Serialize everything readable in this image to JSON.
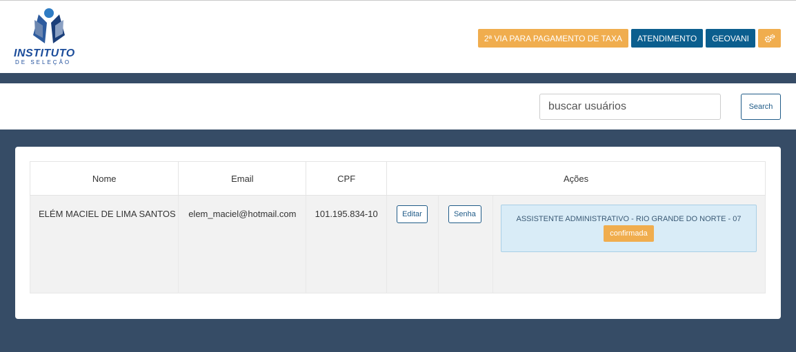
{
  "header": {
    "logo_title": "INSTITUTO",
    "logo_subtitle": "DE SELEÇÃO",
    "nav": {
      "pagamento_label": "2ª VIA PARA PAGAMENTO DE TAXA",
      "atendimento_label": "ATENDIMENTO",
      "user_label": "GEOVANI",
      "settings_icon": "gears-icon"
    },
    "colors": {
      "orange": "#f0ad4e",
      "blue": "#0b5e8e",
      "navy_bg": "#364c66"
    }
  },
  "search": {
    "placeholder": "buscar usuários",
    "value": "",
    "button_label": "Search"
  },
  "table": {
    "headers": {
      "nome": "Nome",
      "email": "Email",
      "cpf": "CPF",
      "acoes": "Ações"
    },
    "rows": [
      {
        "nome": "ELÉM MACIEL DE LIMA SANTOS",
        "email": "elem_maciel@hotmail.com",
        "cpf": "101.195.834-10",
        "edit_label": "Editar",
        "senha_label": "Senha",
        "inscricao": "ASSISTENTE ADMINISTRATIVO - RIO GRANDE DO NORTE - 07",
        "status": "confirmada"
      }
    ]
  }
}
